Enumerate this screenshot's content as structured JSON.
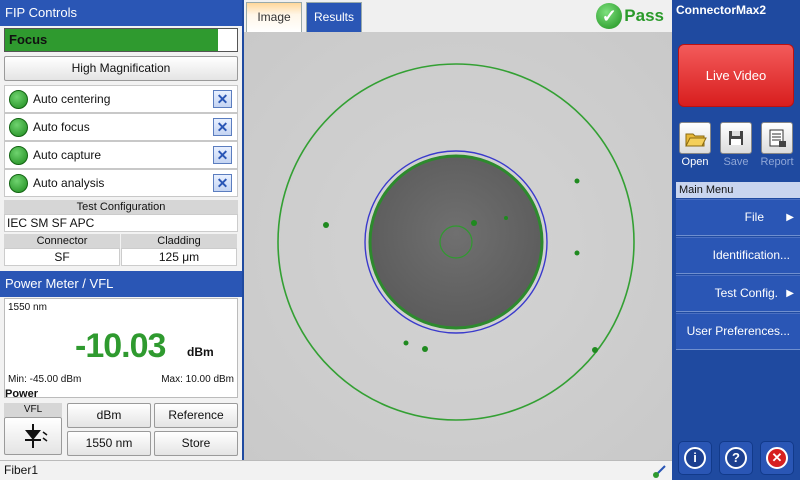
{
  "left": {
    "title": "FIP Controls",
    "focus": {
      "label": "Focus",
      "level": 0.92
    },
    "magnification_button": "High Magnification",
    "auto_items": [
      {
        "label": "Auto centering"
      },
      {
        "label": "Auto focus"
      },
      {
        "label": "Auto capture"
      },
      {
        "label": "Auto analysis"
      }
    ],
    "test_config": {
      "header": "Test Configuration",
      "value": "IEC SM SF APC"
    },
    "connector": {
      "header": "Connector",
      "value": "SF"
    },
    "cladding": {
      "header": "Cladding",
      "value": "125 μm"
    },
    "power_meter": {
      "title": "Power Meter / VFL",
      "wavelength": "1550 nm",
      "value": "-10.03",
      "unit": "dBm",
      "min": "Min: -45.00 dBm",
      "max": "Max: 10.00 dBm",
      "power_label": "Power",
      "vfl_label": "VFL",
      "buttons": {
        "unit": "dBm",
        "reference": "Reference",
        "wavelength": "1550 nm",
        "store": "Store"
      }
    }
  },
  "status_bar": {
    "text": "Fiber1"
  },
  "center": {
    "tabs": [
      "Image",
      "Results"
    ],
    "active_tab": "Image",
    "result": "Pass"
  },
  "right": {
    "app_title": "ConnectorMax2",
    "live_video": "Live Video",
    "tools": [
      {
        "label": "Open",
        "icon": "folder-open-icon"
      },
      {
        "label": "Save",
        "icon": "floppy-disk-icon"
      },
      {
        "label": "Report",
        "icon": "report-icon"
      }
    ],
    "main_menu": {
      "header": "Main Menu",
      "items": [
        {
          "label": "File",
          "arrow": "▶"
        },
        {
          "label": "Identification...",
          "arrow": ""
        },
        {
          "label": "Test Config.",
          "arrow": "▶"
        },
        {
          "label": "User Preferences...",
          "arrow": ""
        }
      ]
    }
  },
  "colors": {
    "header_blue": "#2a56b5",
    "pass_green": "#2f9a2f",
    "live_red": "#d81e1e"
  }
}
